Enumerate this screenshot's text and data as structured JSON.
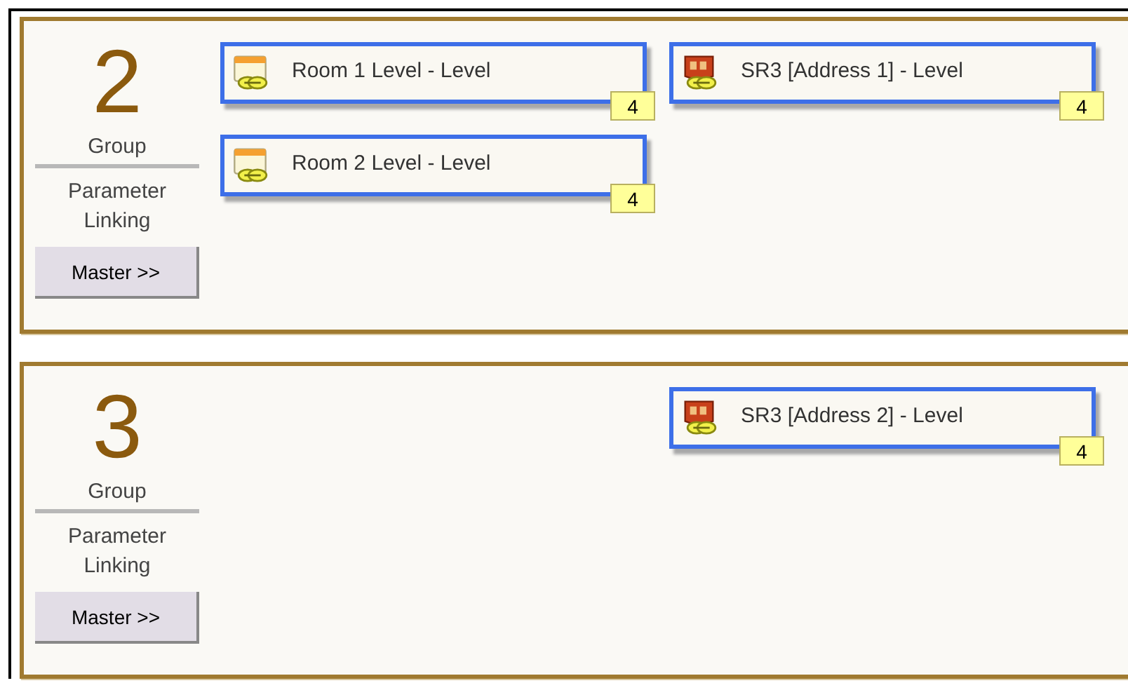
{
  "groups": [
    {
      "number": "2",
      "label": "Group",
      "caption": "Parameter Linking",
      "button": "Master >>",
      "cards": [
        {
          "kind": "device",
          "right_column": false,
          "title": "Room 1 Level - Level",
          "count": "4"
        },
        {
          "kind": "scene",
          "right_column": true,
          "title": "SR3 [Address 1] - Level",
          "count": "4"
        },
        {
          "kind": "device",
          "right_column": false,
          "title": "Room 2 Level - Level",
          "count": "4"
        }
      ]
    },
    {
      "number": "3",
      "label": "Group",
      "caption": "Parameter Linking",
      "button": "Master >>",
      "cards": [
        {
          "kind": "scene",
          "right_column": true,
          "title": "SR3 [Address 2] - Level",
          "count": "4"
        }
      ]
    }
  ]
}
